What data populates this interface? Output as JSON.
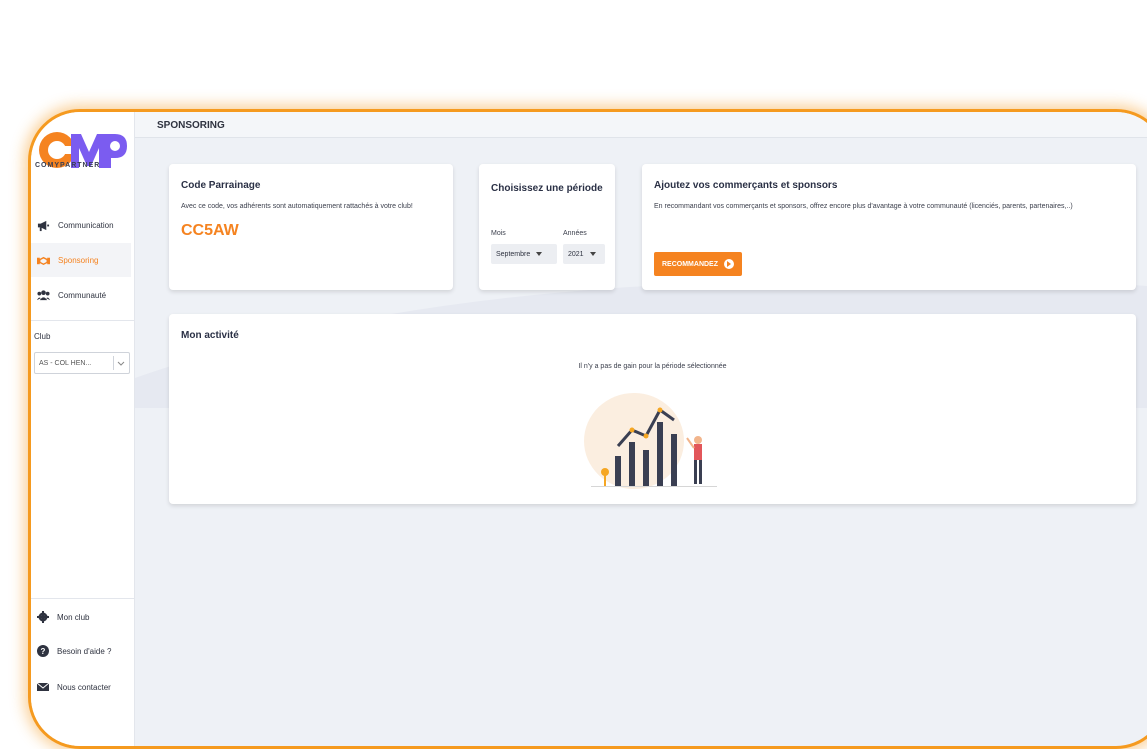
{
  "brand": {
    "logo_text": "COMYPARTNER",
    "accent_color": "#f58320",
    "frame_color": "#f59a1f"
  },
  "sidebar": {
    "items": [
      {
        "label": "Communication",
        "icon": "megaphone-icon"
      },
      {
        "label": "Sponsoring",
        "icon": "handshake-icon",
        "active": true
      },
      {
        "label": "Communauté",
        "icon": "users-icon"
      }
    ],
    "club_label": "Club",
    "club_value": "AS - COL HEN...",
    "bottom": [
      {
        "label": "Mon club",
        "icon": "gear-icon"
      },
      {
        "label": "Besoin d'aide ?",
        "icon": "help-icon"
      },
      {
        "label": "Nous contacter",
        "icon": "mail-icon"
      }
    ]
  },
  "header": {
    "title": "SPONSORING"
  },
  "code_card": {
    "title": "Code Parrainage",
    "description": "Avec ce code, vos adhérents sont automatiquement rattachés à votre club!",
    "code": "CC5AW"
  },
  "period_card": {
    "title": "Choisissez une période",
    "month_label": "Mois",
    "year_label": "Années",
    "month_value": "Septembre",
    "year_value": "2021"
  },
  "sponsor_card": {
    "title": "Ajoutez vos commerçants et sponsors",
    "description": "En recommandant vos commerçants et sponsors, offrez encore plus d'avantage à votre communauté (licenciés, parents, partenaires,..)",
    "button_label": "RECOMMANDEZ"
  },
  "activity_card": {
    "title": "Mon activité",
    "empty_message": "Il n'y a pas de gain pour la période sélectionnée"
  }
}
